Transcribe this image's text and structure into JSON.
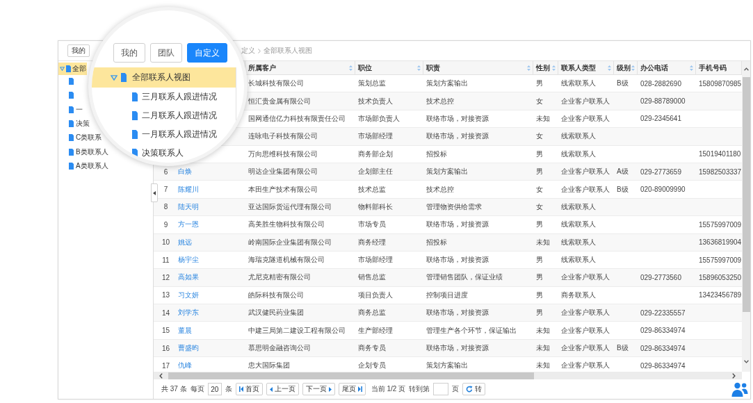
{
  "toolbar": {
    "buttons": [
      {
        "label": "我的",
        "selected": false
      }
    ],
    "breadcrumb": [
      "定义",
      "全部联系人视图"
    ]
  },
  "sidebar": {
    "items": [
      {
        "label": "全部",
        "expanded": true,
        "selected": true,
        "children": [
          {
            "selected": false
          },
          {
            "selected": false
          },
          {
            "label": "一",
            "selected": false
          },
          {
            "label": "决策",
            "selected": false
          },
          {
            "label": "C类联系",
            "selected": false
          },
          {
            "label": "B类联系人",
            "selected": false
          },
          {
            "label": "A类联系人",
            "selected": false
          }
        ]
      }
    ]
  },
  "table": {
    "columns": [
      {
        "label": "所属客户",
        "sortable": true
      },
      {
        "label": "职位",
        "sortable": true
      },
      {
        "label": "职责",
        "sortable": true
      },
      {
        "label": "性别",
        "sortable": true
      },
      {
        "label": "联系人类型",
        "sortable": true
      },
      {
        "label": "级别",
        "sortable": true
      },
      {
        "label": "办公电话",
        "sortable": true
      },
      {
        "label": "手机号码",
        "sortable": false
      }
    ],
    "rows": [
      {
        "company": "长城科技有限公司",
        "position": "策划总监",
        "duty": "策划方案输出",
        "gender": "男",
        "contact_type": "线索联系人",
        "grade": "B级",
        "office_phone": "028-2882690",
        "mobile": "15809870985"
      },
      {
        "company": "恒汇贵金属有限公司",
        "position": "技术负责人",
        "duty": "技术总控",
        "gender": "女",
        "contact_type": "企业客户联系人",
        "office_phone": "029-88789000"
      },
      {
        "company": "国网通信亿力科技有限责任公司",
        "position": "市场部负责人",
        "duty": "联络市场，对接资源",
        "gender": "未知",
        "contact_type": "企业客户联系人",
        "office_phone": "029-2345641"
      },
      {
        "company": "连咏电子科技有限公司",
        "position": "市场部经理",
        "duty": "联络市场，对接资源",
        "gender": "女",
        "contact_type": "线索联系人"
      },
      {
        "company": "万向思维科技有限公司",
        "position": "商务部企划",
        "duty": "招投标",
        "gender": "男",
        "contact_type": "线索联系人",
        "mobile": "15019401180"
      },
      {
        "no": "6",
        "name": "白焕",
        "company": "明达企业集团有限公司",
        "position": "企划部主任",
        "duty": "策划方案输出",
        "gender": "男",
        "contact_type": "企业客户联系人",
        "grade": "A级",
        "office_phone": "029-2773659",
        "mobile": "15982503337"
      },
      {
        "no": "7",
        "name": "陈耀川",
        "company": "本田生产技术有限公司",
        "position": "技术总监",
        "duty": "技术总控",
        "gender": "女",
        "contact_type": "企业客户联系人",
        "grade": "B级",
        "office_phone": "020-89009990"
      },
      {
        "no": "8",
        "name": "陆天明",
        "company": "亚达国际货运代理有限公司",
        "position": "物料部科长",
        "duty": "管理物资供给需求",
        "gender": "女",
        "contact_type": "线索联系人"
      },
      {
        "no": "9",
        "name": "方一恩",
        "company": "高美胜生物科技有限公司",
        "position": "市场专员",
        "duty": "联络市场，对接资源",
        "gender": "男",
        "contact_type": "线索联系人",
        "mobile": "15575997009"
      },
      {
        "no": "10",
        "name": "姚远",
        "company": "岭南国际企业集团有限公司",
        "position": "商务经理",
        "duty": "招投标",
        "gender": "未知",
        "contact_type": "线索联系人",
        "mobile": "13636819904"
      },
      {
        "no": "11",
        "name": "杨宇尘",
        "company": "海瑞克隧道机械有限公司",
        "position": "市场部经理",
        "duty": "联络市场，对接资源",
        "gender": "男",
        "contact_type": "线索联系人",
        "mobile": "15575997009"
      },
      {
        "no": "12",
        "name": "高如果",
        "company": "尤尼克精密有限公司",
        "position": "销售总监",
        "duty": "管理销售团队，保证业绩",
        "gender": "男",
        "contact_type": "企业客户联系人",
        "office_phone": "029-2773560",
        "mobile": "15896053250"
      },
      {
        "no": "13",
        "name": "习文妍",
        "company": "皓际科技有限公司",
        "position": "项目负责人",
        "duty": "控制项目进度",
        "gender": "男",
        "contact_type": "商务联系人",
        "mobile": "13423456789"
      },
      {
        "no": "14",
        "name": "刘学东",
        "company": "武汉健民药业集团",
        "position": "商务总监",
        "duty": "联络市场，对接资源",
        "gender": "男",
        "contact_type": "企业客户联系人",
        "office_phone": "029-22335557"
      },
      {
        "no": "15",
        "name": "董晨",
        "company": "中建三局第二建设工程有限公司",
        "position": "生产部经理",
        "duty": "管理生产各个环节，保证输出",
        "gender": "未知",
        "contact_type": "企业客户联系人",
        "office_phone": "029-86334974"
      },
      {
        "no": "16",
        "name": "曹盛昀",
        "company": "慕思明金融咨询公司",
        "position": "商务专员",
        "duty": "联络市场，对接资源",
        "gender": "未知",
        "contact_type": "企业客户联系人",
        "grade": "B级",
        "office_phone": "029-86334974"
      },
      {
        "no": "17",
        "name": "仇峰",
        "company": "忠大国际集团",
        "position": "企划专员",
        "duty": "策划方案输出",
        "gender": "未知",
        "contact_type": "企业客户联系人",
        "office_phone": "029-86334974"
      }
    ]
  },
  "pager": {
    "total": "共 37 条",
    "per_page_label": "每页",
    "per_page": "20",
    "per_page_unit": "条",
    "buttons": [
      {
        "kind": "first",
        "label": "首页"
      },
      {
        "kind": "prev",
        "label": "上一页"
      },
      {
        "kind": "next",
        "label": "下一页"
      },
      {
        "kind": "last",
        "label": "尾页"
      }
    ],
    "current": "当前 1/2 页",
    "goto_label": "转到第",
    "goto_unit": "页",
    "go_button": "转"
  },
  "magnifier": {
    "buttons": [
      {
        "label": "我的",
        "selected": false
      },
      {
        "label": "团队",
        "selected": false
      },
      {
        "label": "自定义",
        "selected": true
      }
    ],
    "tree": [
      {
        "label": "全部联系人视图",
        "expanded": true,
        "selected": true,
        "children": [
          {
            "label": "三月联系人跟进情况",
            "selected": false
          },
          {
            "label": "二月联系人跟进情况",
            "selected": false
          },
          {
            "label": "一月联系人跟进情况",
            "selected": false
          },
          {
            "label": "决策联系人",
            "selected": false
          }
        ]
      }
    ]
  }
}
